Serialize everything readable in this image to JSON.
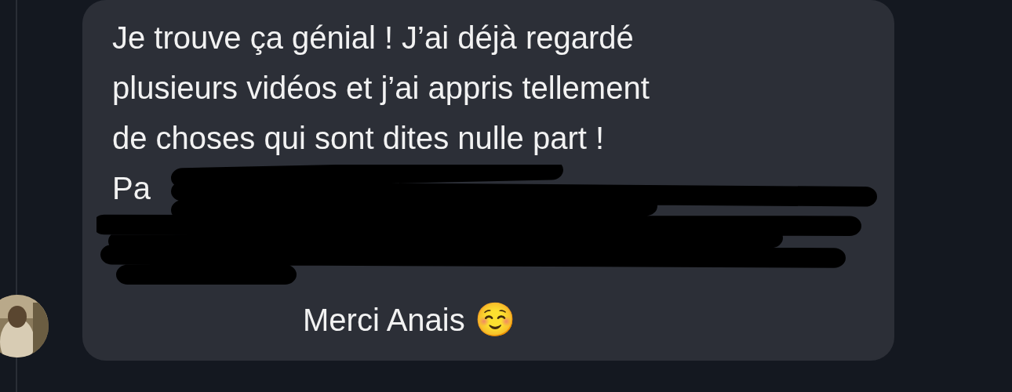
{
  "message": {
    "lines": [
      "Je trouve ça génial ! J’ai déjà regardé",
      "plusieurs vidéos et j’ai appris tellement",
      "de choses qui sont dites nulle part !"
    ],
    "partial_line": "Pa",
    "redacted": true,
    "closing": "Merci Anais",
    "emoji": "☺️"
  }
}
